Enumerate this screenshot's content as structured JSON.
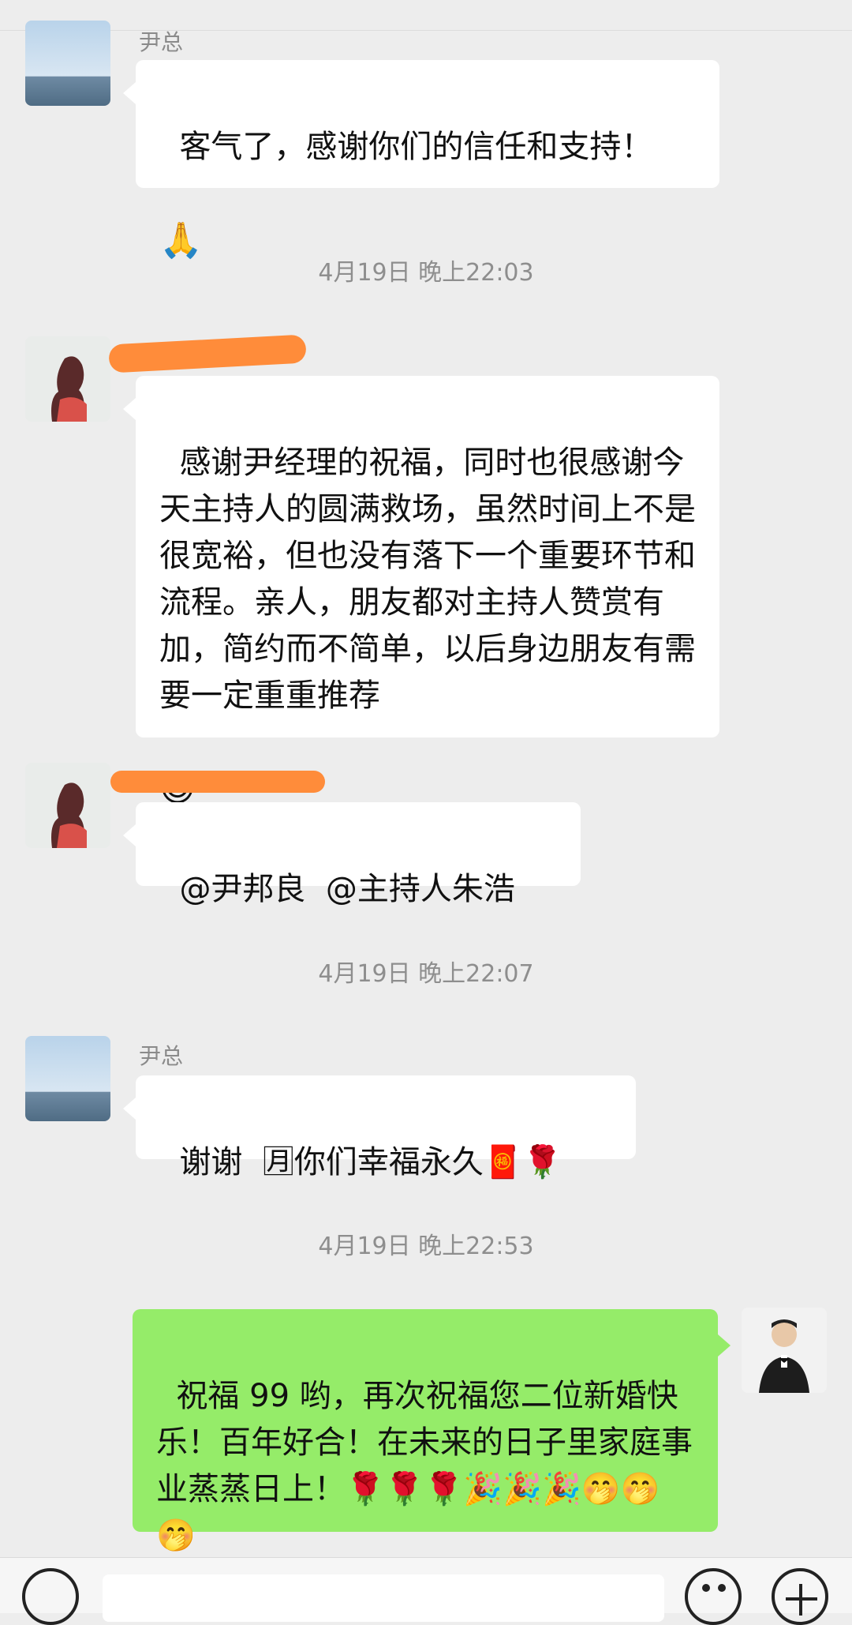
{
  "messages": [
    {
      "sender": "尹总",
      "text": "客气了，感谢你们的信任和支持！",
      "emoji": "🙏"
    },
    {
      "time": "4月19日 晚上22:03"
    },
    {
      "text": "感谢尹经理的祝福，同时也很感谢今天主持人的圆满救场，虽然时间上不是很宽裕，但也没有落下一个重要环节和流程。亲人，朋友都对主持人赞赏有加，简约而不简单，以后身边朋友有需要一定重重推荐",
      "emoji": "😎"
    },
    {
      "text": "@尹邦良  @主持人朱浩"
    },
    {
      "time": "4月19日 晚上22:07"
    },
    {
      "sender": "尹总",
      "text": "谢谢  🈷你们幸福永久🧧🌹"
    },
    {
      "time": "4月19日 晚上22:53"
    },
    {
      "text": "祝福 99 哟，再次祝福您二位新婚快乐！百年好合！在未来的日子里家庭事业蒸蒸日上！🌹🌹🌹🎉🎉🎉🤭🤭🤭"
    }
  ],
  "colors": {
    "background": "#ededed",
    "incoming_bubble": "#ffffff",
    "outgoing_bubble": "#95ec69",
    "timestamp": "#8e8e8e",
    "redaction": "#ff8c3a"
  },
  "icons": [
    "voice-icon",
    "emoji-icon",
    "plus-icon"
  ]
}
